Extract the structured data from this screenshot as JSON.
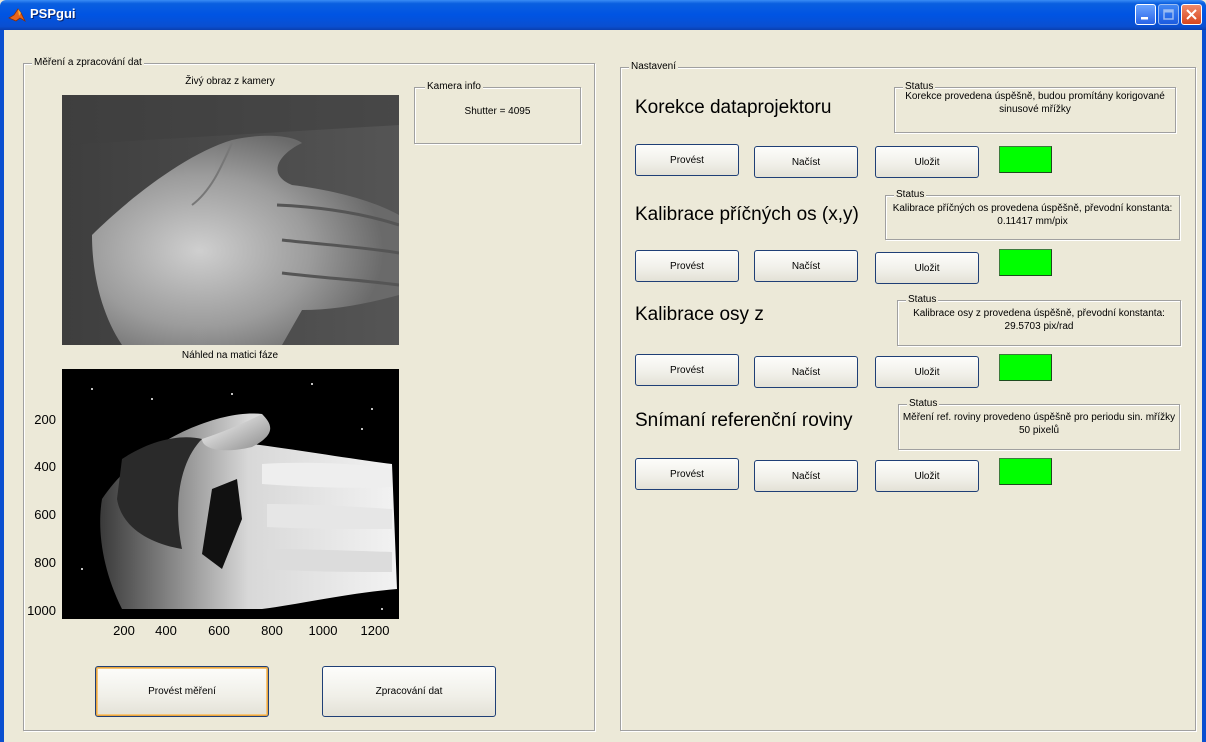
{
  "window": {
    "title": "PSPgui"
  },
  "left_panel": {
    "title": "Měření a zpracování dat",
    "camera_label": "Živý obraz z kamery",
    "phase_label": "Náhled na matici fáze",
    "camera_info": {
      "title": "Kamera info",
      "text": "Shutter = 4095"
    },
    "phase_axes": {
      "y_ticks": [
        "200",
        "400",
        "600",
        "800",
        "1000"
      ],
      "x_ticks": [
        "200",
        "400",
        "600",
        "800",
        "1000",
        "1200"
      ]
    },
    "measure_button": "Provést měření",
    "process_button": "Zpracování dat"
  },
  "right_panel": {
    "title": "Nastavení",
    "status_title": "Status",
    "button_labels": {
      "run": "Provést",
      "load": "Načíst",
      "save": "Uložit"
    },
    "sections": [
      {
        "id": "projector",
        "title": "Korekce dataprojektoru",
        "status": "Korekce provedena úspěšně, budou promítány korigované sinusové mřížky",
        "led": true
      },
      {
        "id": "xy",
        "title": "Kalibrace příčných os (x,y)",
        "status": "Kalibrace příčných os provedena úspěšně, převodní konstanta: 0.11417 mm/pix",
        "led": true
      },
      {
        "id": "z",
        "title": "Kalibrace osy z",
        "status": "Kalibrace osy z provedena úspěšně, převodní konstanta: 29.5703 pix/rad",
        "led": true
      },
      {
        "id": "ref",
        "title": "Snímaní referenční roviny",
        "status": "Měření ref. roviny provedeno úspěšně pro periodu sin. mřížky 50 pixelů",
        "led": true
      }
    ]
  },
  "colors": {
    "led_ok": "#00ff00",
    "titlebar": "#0054e3",
    "window_bg": "#ece9d8"
  }
}
